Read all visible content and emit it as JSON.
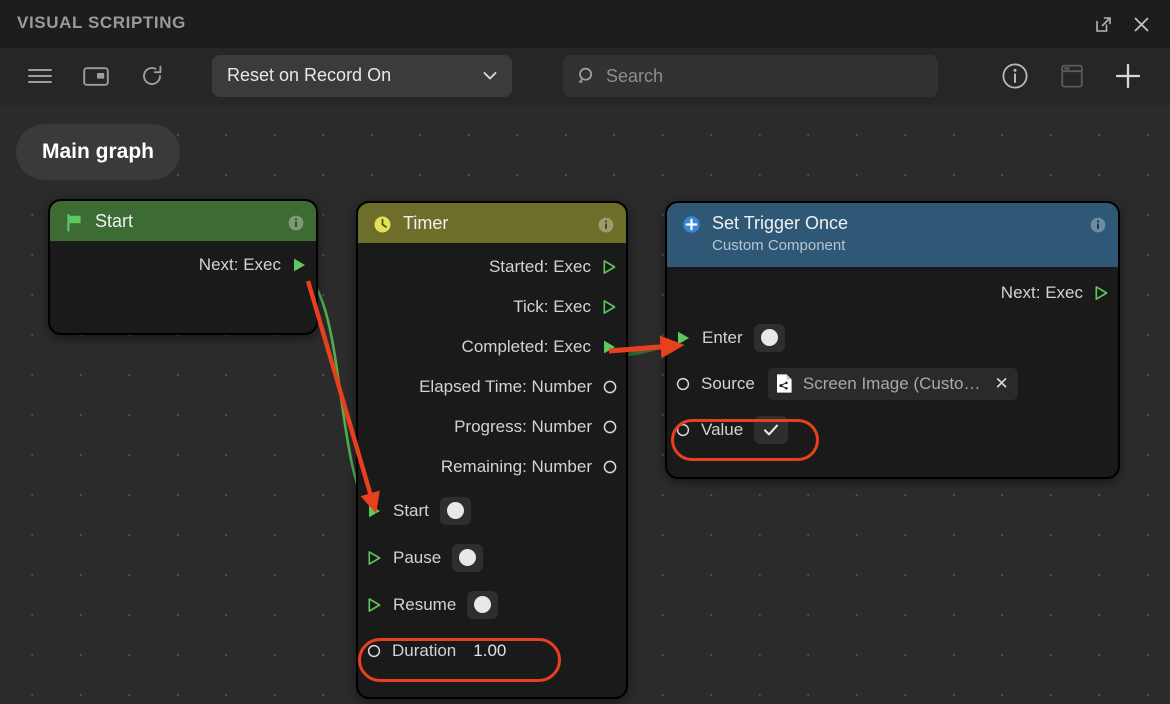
{
  "window": {
    "title": "VISUAL SCRIPTING",
    "popout_icon": "external-link-icon",
    "close_icon": "close-icon"
  },
  "toolbar": {
    "menu_icon": "hamburger-menu-icon",
    "panel_icon": "panel-layout-icon",
    "refresh_icon": "refresh-icon",
    "graph_selector": {
      "value": "Reset on Record On",
      "caret_icon": "chevron-down-icon"
    },
    "search": {
      "placeholder": "Search",
      "value": "",
      "icon": "search-icon"
    },
    "info_icon": "info-circle-icon",
    "window_icon": "window-icon",
    "add_icon": "plus-icon"
  },
  "canvas": {
    "graph_tab": "Main graph",
    "background": "#2b2b2b"
  },
  "nodes": [
    {
      "id": "start",
      "title": "Start",
      "subtitle": "",
      "icon": "flag-icon",
      "header_color": "#3c6b33",
      "info_icon": "info-icon",
      "outputs": [
        {
          "label": "Next: Exec",
          "port": "exec",
          "connected": true
        }
      ],
      "inputs": []
    },
    {
      "id": "timer",
      "title": "Timer",
      "subtitle": "",
      "icon": "clock-icon",
      "header_color": "#6e6e2b",
      "info_icon": "info-icon",
      "outputs": [
        {
          "label": "Started: Exec",
          "port": "exec",
          "connected": false
        },
        {
          "label": "Tick: Exec",
          "port": "exec",
          "connected": false
        },
        {
          "label": "Completed: Exec",
          "port": "exec",
          "connected": true
        },
        {
          "label": "Elapsed Time: Number",
          "port": "number",
          "connected": false
        },
        {
          "label": "Progress: Number",
          "port": "number",
          "connected": false
        },
        {
          "label": "Remaining: Number",
          "port": "number",
          "connected": false
        }
      ],
      "inputs": [
        {
          "label": "Start",
          "port": "exec",
          "connected": true,
          "widget": "dot"
        },
        {
          "label": "Pause",
          "port": "exec",
          "connected": false,
          "widget": "dot"
        },
        {
          "label": "Resume",
          "port": "exec",
          "connected": false,
          "widget": "dot"
        },
        {
          "label": "Duration",
          "port": "number",
          "connected": false,
          "widget": "number",
          "value": "1.00",
          "highlighted": true
        }
      ]
    },
    {
      "id": "set-trigger-once",
      "title": "Set Trigger Once",
      "subtitle": "Custom Component",
      "icon": "plus-circle-icon",
      "header_color": "#2e5875",
      "info_icon": "info-icon",
      "outputs": [
        {
          "label": "Next: Exec",
          "port": "exec",
          "connected": false
        }
      ],
      "inputs": [
        {
          "label": "Enter",
          "port": "exec",
          "connected": true,
          "widget": "dot"
        },
        {
          "label": "Source",
          "port": "number",
          "connected": false,
          "widget": "object",
          "value": "Screen Image (Custo…",
          "object_icon": "script-file-icon",
          "clear_icon": "close-icon"
        },
        {
          "label": "Value",
          "port": "number",
          "connected": false,
          "widget": "check",
          "checked": true,
          "highlighted": true
        }
      ]
    }
  ],
  "connections": [
    {
      "from": "start.Next: Exec",
      "to": "timer.Start",
      "color": "#4faf4f"
    },
    {
      "from": "timer.Completed: Exec",
      "to": "set-trigger-once.Enter",
      "color": "#4faf4f"
    }
  ],
  "annotations": {
    "arrow_color": "#e8401f",
    "ring_color": "#e8401f",
    "arrows": [
      {
        "label": "start-to-timer-start-arrow"
      },
      {
        "label": "completed-to-enter-arrow"
      }
    ],
    "rings": [
      {
        "label": "duration-highlight-ring"
      },
      {
        "label": "value-highlight-ring"
      }
    ]
  },
  "colors": {
    "exec_green": "#5ec75e",
    "port_white": "#e0e0e0",
    "accent_red": "#e8401f"
  }
}
